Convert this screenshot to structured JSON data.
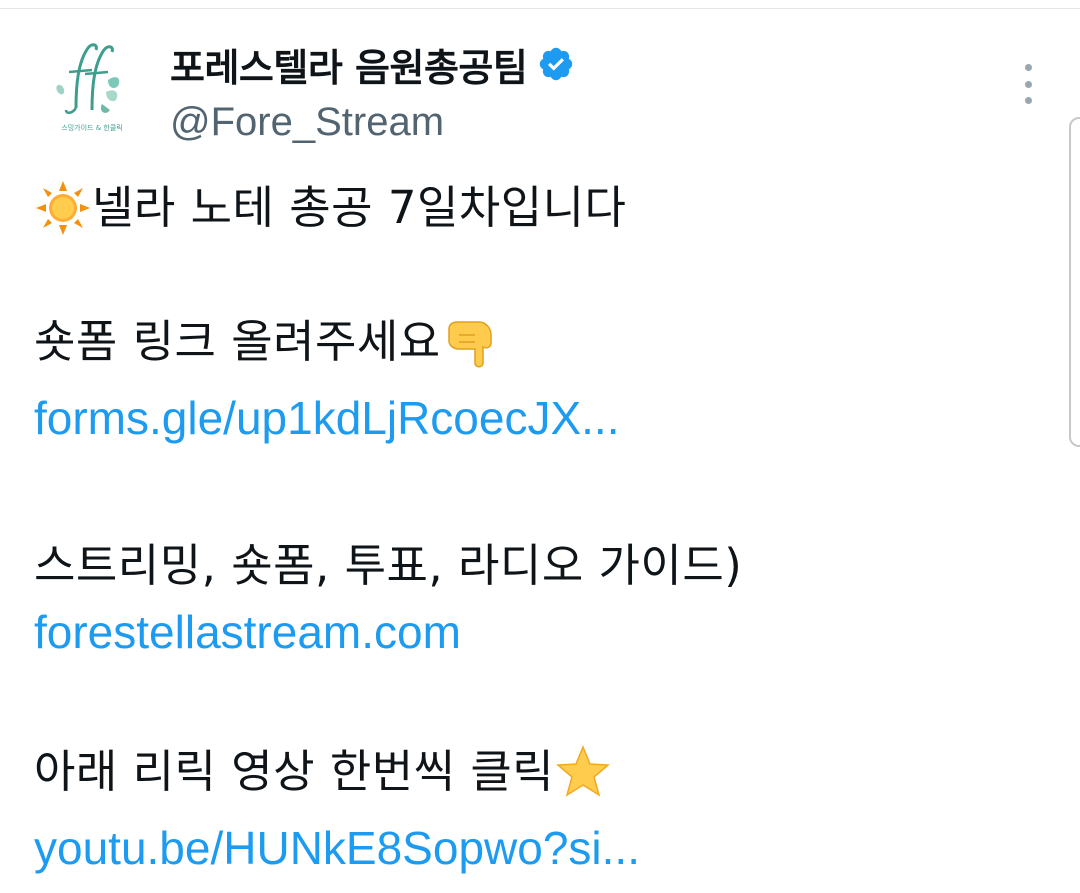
{
  "tweet": {
    "author": {
      "display_name": "포레스텔라 음원총공팀",
      "handle": "@Fore_Stream",
      "verified": true,
      "avatar_caption": "스밍가이드 & 한클릭"
    },
    "more_icon": "three-dots-vertical",
    "lines": {
      "l1_text": "넬라 노테 총공 7일차입니다",
      "l1_emoji": "sun",
      "l2_text": "숏폼 링크 올려주세요",
      "l2_emoji": "pointing-down-hand",
      "l3_link": "forms.gle/up1kdLjRcoecJX...",
      "l4_text": "스트리밍, 숏폼, 투표, 라디오 가이드)",
      "l5_link": "forestellastream.com",
      "l6_text": "아래 리릭 영상 한번씩 클릭",
      "l6_emoji": "star",
      "l7_link": "youtu.be/HUNkE8Sopwo?si..."
    }
  },
  "colors": {
    "link": "#1d9bf0",
    "text": "#0f1419",
    "handle": "#536471",
    "verified": "#1d9bf0"
  }
}
